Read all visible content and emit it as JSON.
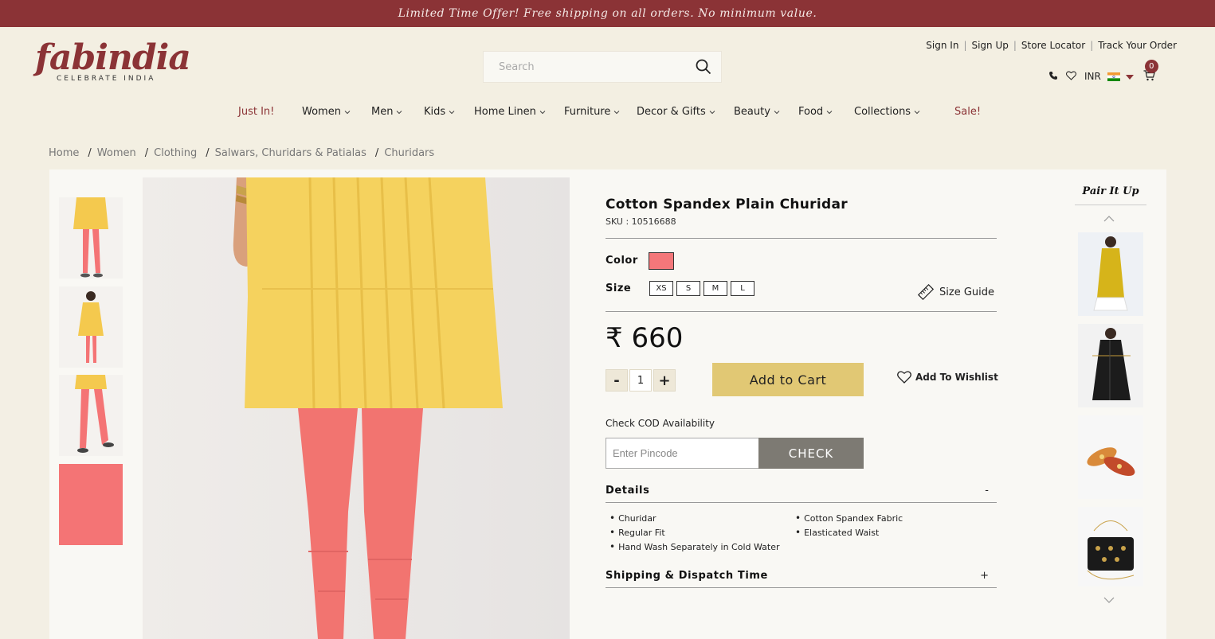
{
  "promo": {
    "text": "Limited Time Offer! Free shipping on all orders. No minimum value."
  },
  "brand": {
    "name": "fabindia",
    "tagline": "CELEBRATE INDIA",
    "color": "#8b3336"
  },
  "search": {
    "placeholder": "Search",
    "value": "",
    "icon": "search-icon"
  },
  "account_links": [
    "Sign In",
    "Sign Up",
    "Store Locator",
    "Track Your Order"
  ],
  "utility": {
    "currency": "INR",
    "cart_count": "0",
    "icons": [
      "phone-icon",
      "heart-icon",
      "india-flag-icon",
      "caret-down-icon",
      "cart-icon"
    ]
  },
  "nav": [
    {
      "label": "Just In!",
      "dropdown": false,
      "highlight": true
    },
    {
      "label": "Women",
      "dropdown": true,
      "highlight": false
    },
    {
      "label": "Men",
      "dropdown": true,
      "highlight": false
    },
    {
      "label": "Kids",
      "dropdown": true,
      "highlight": false
    },
    {
      "label": "Home Linen",
      "dropdown": true,
      "highlight": false
    },
    {
      "label": "Furniture",
      "dropdown": true,
      "highlight": false
    },
    {
      "label": "Decor & Gifts",
      "dropdown": true,
      "highlight": false
    },
    {
      "label": "Beauty",
      "dropdown": true,
      "highlight": false
    },
    {
      "label": "Food",
      "dropdown": true,
      "highlight": false
    },
    {
      "label": "Collections",
      "dropdown": true,
      "highlight": false
    },
    {
      "label": "Sale!",
      "dropdown": false,
      "highlight": true
    }
  ],
  "breadcrumb": [
    "Home",
    "Women",
    "Clothing",
    "Salwars, Churidars & Patialas",
    "Churidars"
  ],
  "product": {
    "title": "Cotton Spandex Plain Churidar",
    "sku": "SKU : 10516688",
    "color_label": "Color",
    "color_swatch": "#f4777a",
    "size_label": "Size",
    "sizes": [
      "XS",
      "S",
      "M",
      "L"
    ],
    "size_guide": "Size Guide",
    "price": "₹ 660",
    "qty_minus": "-",
    "qty_value": "1",
    "qty_plus": "+",
    "add_to_cart": "Add to Cart",
    "add_to_wishlist": "Add To Wishlist"
  },
  "cod": {
    "label": "Check COD Availability",
    "placeholder": "Enter Pincode",
    "button": "CHECK"
  },
  "details": {
    "title": "Details",
    "state": "-",
    "items": [
      "Churidar",
      "Cotton Spandex Fabric",
      "Regular Fit",
      "Elasticated Waist",
      "Hand Wash Separately in Cold Water"
    ]
  },
  "shipping": {
    "title": "Shipping & Dispatch Time",
    "state": "+"
  },
  "pair_it_up": {
    "title": "Pair It Up"
  }
}
